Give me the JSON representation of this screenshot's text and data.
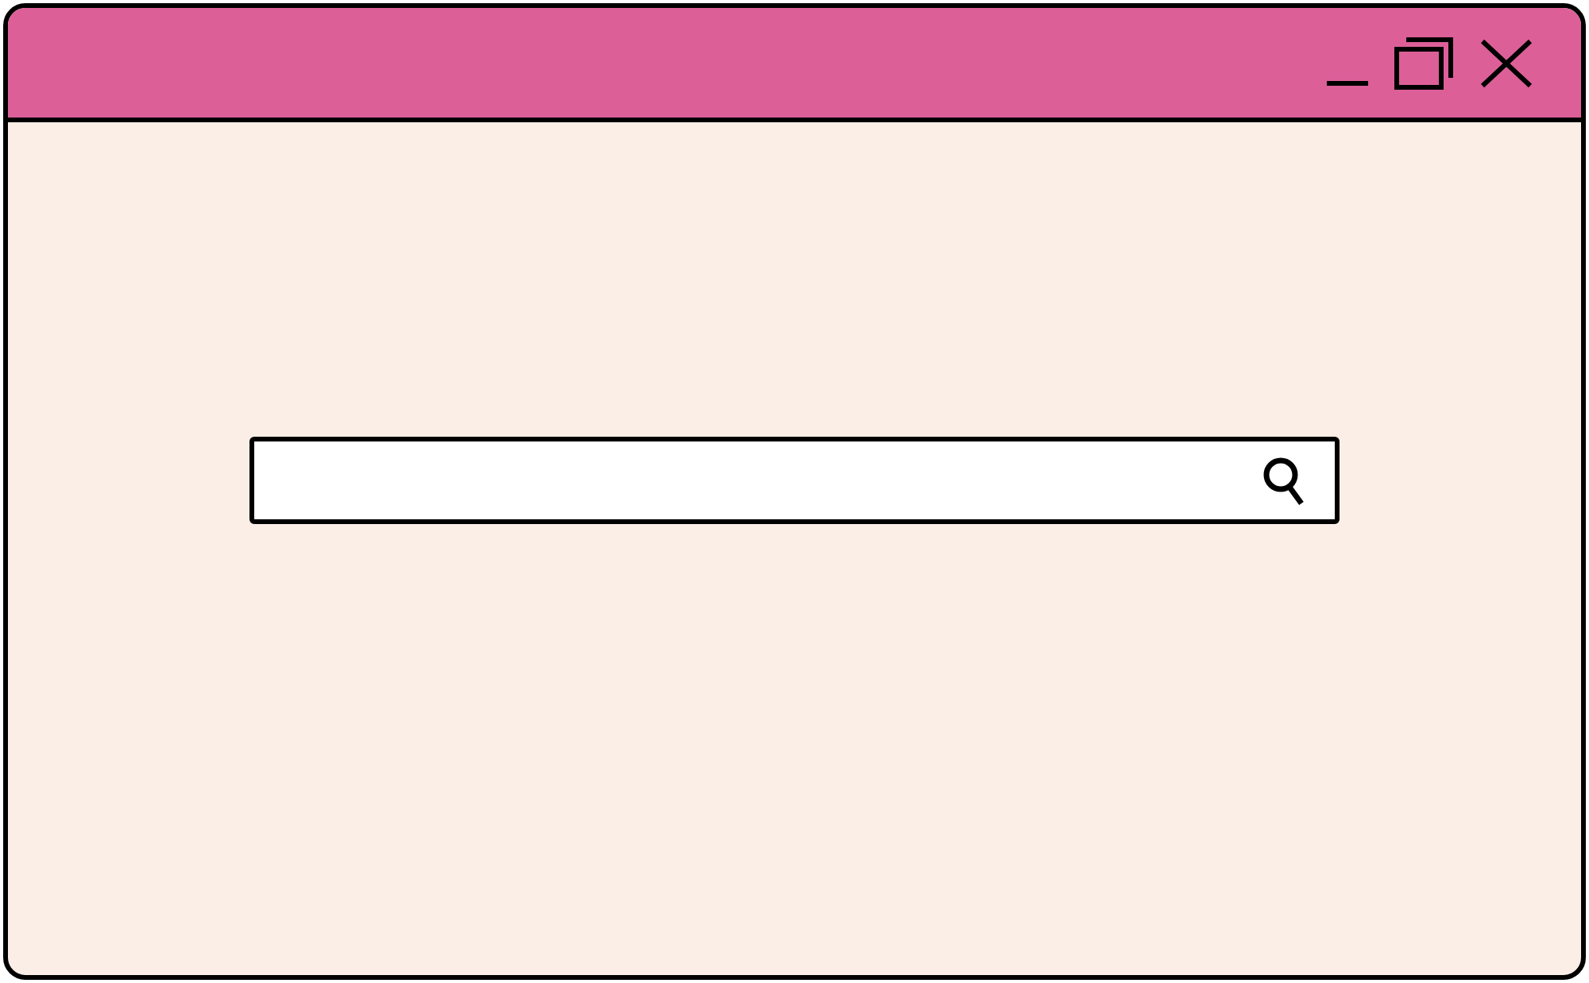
{
  "window": {
    "controls": [
      {
        "kind": "minimize"
      },
      {
        "kind": "maximize"
      },
      {
        "kind": "close"
      }
    ]
  },
  "search": {
    "kind": "field"
  }
}
